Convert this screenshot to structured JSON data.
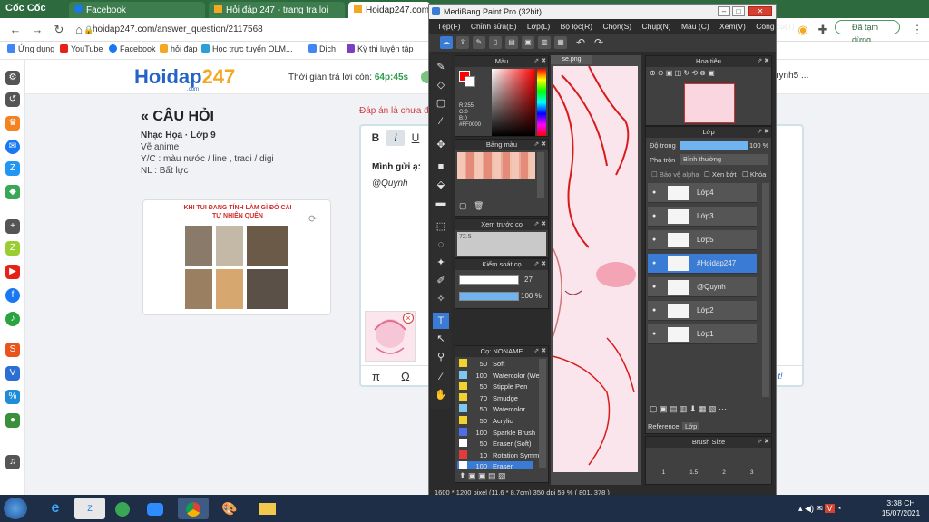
{
  "browser": {
    "brand": "Cốc Cốc",
    "tabs": [
      {
        "label": "Facebook"
      },
      {
        "label": "Hỏi đáp 247 - trang tra loi"
      },
      {
        "label": "Hoidap247.com"
      }
    ],
    "address": "hoidap247.com/answer_question/2117568",
    "bookmarks": [
      "Ứng dụng",
      "YouTube",
      "Facebook",
      "hỏi đáp",
      "Học trực tuyến OLM...",
      "Dịch",
      "Kỳ thi luyện tập"
    ],
    "user_button": "Đã tạm dừng"
  },
  "page": {
    "logo_main": "Hoidap",
    "logo_num": "247",
    "logo_sub": ".com",
    "timer_label": "Thời gian trả lời còn:",
    "timer_value": "64p:45s",
    "right_user": "uynh5 ...",
    "question": {
      "heading": "« CÂU HỎI",
      "meta": "Nhạc Họa · Lớp 9",
      "lines": [
        "Vẽ anime",
        "Y/C : màu nước / line , tradi / digi",
        "NL : Bất lực"
      ],
      "meme_text": "KHI TUI ĐANG TÍNH LÀM GÌ ĐÓ CÁI TỰ NHIÊN QUÊN"
    },
    "answer": {
      "note": "Đáp án là chưa đ",
      "line1": "Mình gửi ạ:",
      "line2": "@Quynh",
      "review_link": "duyệt!",
      "toolbar": [
        "B",
        "I",
        "U"
      ],
      "math_pi": "π",
      "math_omega": "Ω"
    }
  },
  "medibang": {
    "title": "MediBang Paint Pro (32bit)",
    "menu": [
      "Tệp(F)",
      "Chỉnh sửa(E)",
      "Lớp(L)",
      "Bộ lọc(R)",
      "Chọn(S)",
      "Chụp(N)",
      "Màu (C)",
      "Xem(V)",
      "Công cụ(T)"
    ],
    "panels": {
      "color": "Màu",
      "color_readout": [
        "R:255",
        "G:0",
        "B:0",
        "#FF0000"
      ],
      "palette": "Bảng màu",
      "preview": "Xem trước cọ",
      "preview_value": "72.5",
      "brush_control": "Kiểm soát cọ",
      "brush_size": "27",
      "brush_opacity": "100 %",
      "brushes_title": "Cọ: NONAME",
      "navigator": "Hoa tiêu",
      "layer_panel": "Lớp",
      "opacity_label": "Độ trong",
      "opacity_value": "100 %",
      "blend_label": "Pha trộn",
      "blend_value": "Bình thường",
      "protect_alpha": "Bảo vệ alpha",
      "clip": "Xén bớt",
      "lock": "Khóa",
      "reference_tab": "Reference",
      "layer_tab": "Lớp",
      "brush_size_panel": "Brush Size"
    },
    "canvas_tab": "se.png",
    "layers": [
      {
        "name": "Lớp4"
      },
      {
        "name": "Lớp3"
      },
      {
        "name": "Lớp5"
      },
      {
        "name": "#Hoidap247"
      },
      {
        "name": "@Quynh"
      },
      {
        "name": "Lớp2"
      },
      {
        "name": "Lớp1"
      }
    ],
    "brushes": [
      {
        "size": "50",
        "name": "Soft",
        "color": "#f2d22e"
      },
      {
        "size": "100",
        "name": "Watercolor (Wet)",
        "color": "#7ec8f0"
      },
      {
        "size": "50",
        "name": "Stipple Pen",
        "color": "#f2d22e"
      },
      {
        "size": "70",
        "name": "Smudge",
        "color": "#f2d22e"
      },
      {
        "size": "50",
        "name": "Watercolor",
        "color": "#7ec8f0"
      },
      {
        "size": "50",
        "name": "Acrylic",
        "color": "#f2d22e"
      },
      {
        "size": "100",
        "name": "Sparkle Brush",
        "color": "#4c6fe6"
      },
      {
        "size": "50",
        "name": "Eraser (Soft)",
        "color": "#ffffff"
      },
      {
        "size": "10",
        "name": "Rotation Symmetry",
        "color": "#e33b3b"
      },
      {
        "size": "100",
        "name": "Eraser",
        "color": "#ffffff"
      }
    ],
    "brush_size_ticks": [
      "1",
      "1.5",
      "2",
      "3"
    ],
    "status": "1600 * 1200 pixel   (11.6 * 8.7cm)   350 dpi   59 %   ( 801, 378 )"
  },
  "taskbar": {
    "time": "3:38 CH",
    "date": "15/07/2021"
  }
}
